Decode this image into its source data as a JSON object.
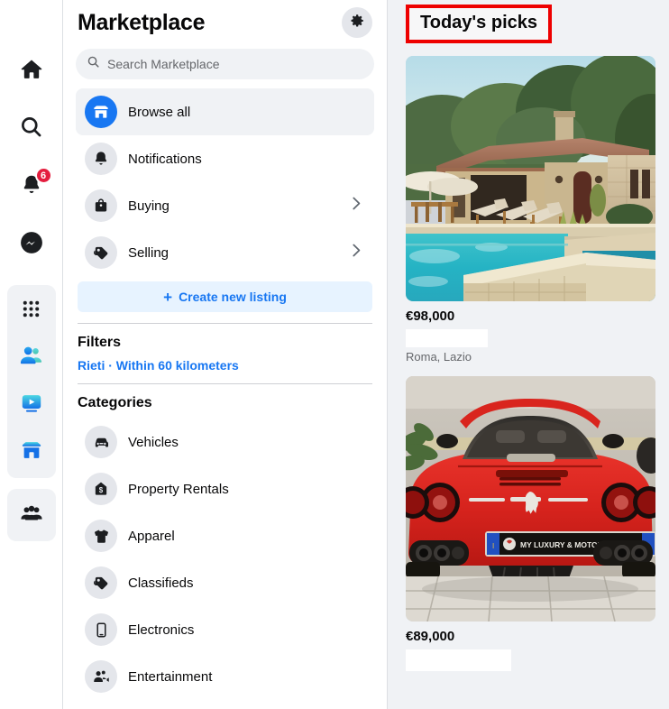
{
  "rail": {
    "items": [
      {
        "name": "home",
        "icon": "home-icon",
        "badge": null
      },
      {
        "name": "search",
        "icon": "search-icon",
        "badge": null
      },
      {
        "name": "notifications",
        "icon": "bell-icon",
        "badge": "6"
      },
      {
        "name": "messenger",
        "icon": "messenger-icon",
        "badge": null
      }
    ],
    "group1": [
      {
        "name": "menu",
        "icon": "grid-menu-icon"
      },
      {
        "name": "friends",
        "icon": "friends-icon"
      },
      {
        "name": "video",
        "icon": "video-icon"
      },
      {
        "name": "marketplace",
        "icon": "marketplace-store-icon"
      }
    ],
    "group2": [
      {
        "name": "groups",
        "icon": "groups-icon"
      }
    ]
  },
  "sidebar": {
    "title": "Marketplace",
    "settings_icon": "gear-icon",
    "search": {
      "placeholder": "Search Marketplace",
      "value": "",
      "icon": "search-icon"
    },
    "nav": [
      {
        "label": "Browse all",
        "icon": "store-icon",
        "active": true,
        "chevron": false
      },
      {
        "label": "Notifications",
        "icon": "bell-icon",
        "active": false,
        "chevron": false
      },
      {
        "label": "Buying",
        "icon": "bag-icon",
        "active": false,
        "chevron": true
      },
      {
        "label": "Selling",
        "icon": "tag-icon",
        "active": false,
        "chevron": true
      }
    ],
    "create_listing": {
      "label": "Create new listing",
      "icon": "plus-icon",
      "plus": "+"
    },
    "filters": {
      "heading": "Filters",
      "location_label": "Rieti · Within 60 kilometers"
    },
    "categories": {
      "heading": "Categories",
      "items": [
        {
          "label": "Vehicles",
          "icon": "car-icon"
        },
        {
          "label": "Property Rentals",
          "icon": "house-dollar-icon"
        },
        {
          "label": "Apparel",
          "icon": "tshirt-icon"
        },
        {
          "label": "Classifieds",
          "icon": "tag-icon"
        },
        {
          "label": "Electronics",
          "icon": "phone-icon"
        },
        {
          "label": "Entertainment",
          "icon": "entertainment-icon"
        }
      ]
    }
  },
  "main": {
    "section_title": "Today's picks",
    "highlight_color": "#ee0000",
    "listings": [
      {
        "price": "€98,000",
        "title_redacted": true,
        "location": "Roma, Lazio",
        "image_alt": "mediterranean-villa-with-pool"
      },
      {
        "price": "€89,000",
        "title_redacted": true,
        "location": "",
        "image_alt": "red-ferrari-rear-view"
      }
    ]
  },
  "colors": {
    "accent": "#1877f2",
    "bg": "#f0f2f5",
    "text": "#080809",
    "muted": "#65676b",
    "badge": "#e41e3f"
  }
}
